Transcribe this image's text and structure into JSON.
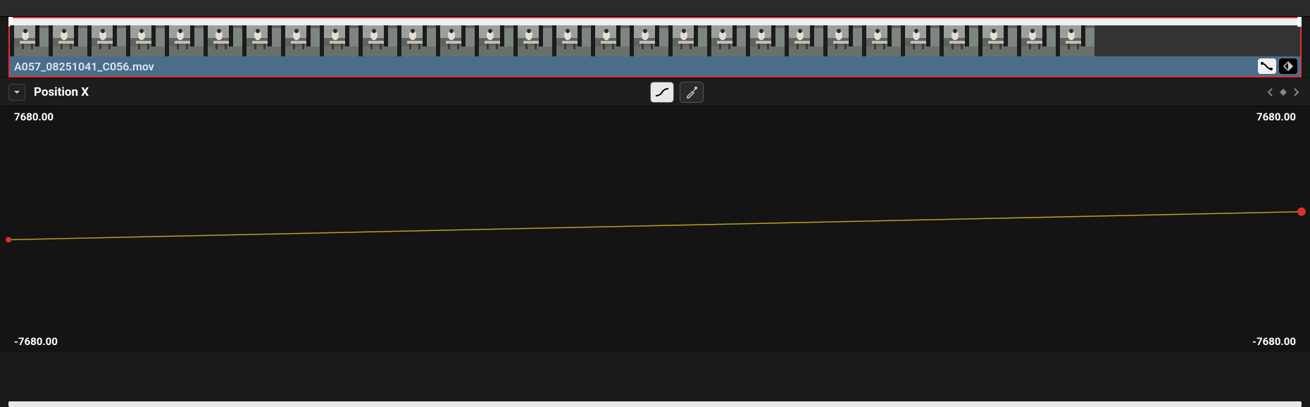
{
  "clip": {
    "filename": "A057_08251041_C056.mov"
  },
  "parameter": {
    "name": "Position X",
    "axis_max": "7680.00",
    "axis_min": "-7680.00"
  },
  "chart_data": {
    "type": "line",
    "title": "Position X",
    "xlabel": "",
    "ylabel": "",
    "ylim": [
      -7680,
      7680
    ],
    "x": [
      0,
      1
    ],
    "values": [
      -300,
      600
    ],
    "series": [
      {
        "name": "Position X",
        "values": [
          -300,
          600
        ]
      }
    ]
  },
  "icons": {
    "curve_editor": "curve-editor-icon",
    "keyframe": "keyframe-icon",
    "dropdown": "dropdown-icon",
    "ease_curve": "ease-curve-icon",
    "eyedropper": "eyedropper-icon",
    "prev": "chevron-left-icon",
    "diamond": "keyframe-diamond-icon",
    "next": "chevron-right-icon"
  }
}
